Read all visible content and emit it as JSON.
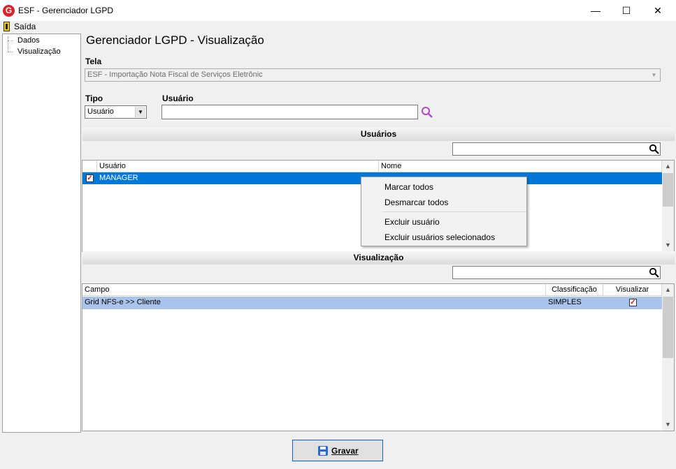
{
  "window": {
    "title": "ESF - Gerenciador LGPD",
    "logo_letter": "G",
    "controls": {
      "minimize": "—",
      "maximize": "☐",
      "close": "✕"
    }
  },
  "menu": {
    "exit_label": "Saída",
    "exit_icon": "door-exit-icon"
  },
  "tree": {
    "items": [
      "Dados",
      "Visualização"
    ]
  },
  "page": {
    "title": "Gerenciador LGPD - Visualização"
  },
  "tela": {
    "label": "Tela",
    "value": "ESF - Importação Nota Fiscal de Serviços Eletrônic"
  },
  "filter": {
    "tipo_label": "Tipo",
    "tipo_value": "Usuário",
    "usuario_label": "Usuário",
    "usuario_value": "",
    "search_icon": "magnifier-icon",
    "search_icon_color": "#b048c8"
  },
  "users_section": {
    "title": "Usuários",
    "search_value": "",
    "columns": [
      "",
      "Usuário",
      "Nome"
    ],
    "rows": [
      {
        "checked": true,
        "usuario": "MANAGER",
        "nome": ""
      }
    ],
    "selected_row_color": "#0078d7"
  },
  "context_menu": {
    "items": [
      "Marcar todos",
      "Desmarcar todos",
      "Excluir usuário",
      "Excluir usuários selecionados"
    ]
  },
  "view_section": {
    "title": "Visualização",
    "search_value": "",
    "columns": [
      "Campo",
      "Classificação",
      "Visualizar"
    ],
    "rows": [
      {
        "campo": "Grid NFS-e >> Cliente",
        "classificacao": "SIMPLES",
        "visualizar": true
      }
    ],
    "selected_row_color": "#a9c4ea"
  },
  "footer": {
    "save_label": "Gravar",
    "save_icon": "floppy-disk-icon"
  }
}
